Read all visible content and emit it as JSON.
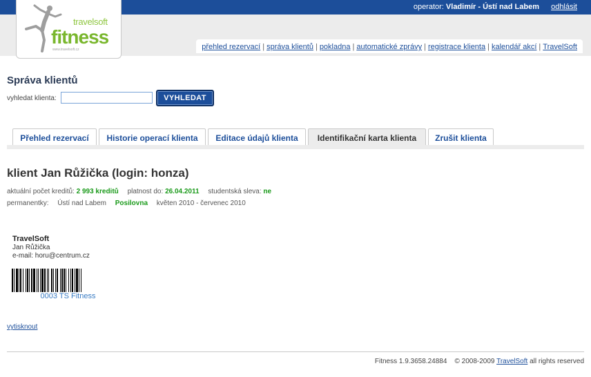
{
  "header": {
    "operator_label": "operator:",
    "operator_name": "Vladimír - Ústí nad Labem",
    "logout_label": "odhlásit"
  },
  "logo": {
    "brand_top": "travelsoft",
    "brand_main": "fitness",
    "tagline": "www.travelsoft.cz",
    "colors": {
      "green": "#7ab72e",
      "figure": "#9e9e9e"
    }
  },
  "nav": {
    "items": [
      {
        "label": "přehled rezervací"
      },
      {
        "label": "správa klientů"
      },
      {
        "label": "pokladna"
      },
      {
        "label": "automatické zprávy"
      },
      {
        "label": "registrace klienta"
      },
      {
        "label": "kalendář akcí"
      },
      {
        "label": "TravelSoft"
      }
    ],
    "separator": "|"
  },
  "search": {
    "title": "Správa klientů",
    "label": "vyhledat klienta:",
    "value": "",
    "placeholder": "",
    "button_label": "VYHLEDAT"
  },
  "tabs": {
    "items": [
      {
        "label": "Přehled rezervací"
      },
      {
        "label": "Historie operací klienta"
      },
      {
        "label": "Editace údajů klienta"
      },
      {
        "label": "Identifikační karta klienta",
        "active": true
      },
      {
        "label": "Zrušit klienta"
      }
    ]
  },
  "client": {
    "title": "klient Jan Růžička (login: honza)",
    "credits_label": "aktuální počet kreditů:",
    "credits_value": "2 993 kreditů",
    "valid_label": "platnost do:",
    "valid_value": "26.04.2011",
    "discount_label": "studentská sleva:",
    "discount_value": "ne",
    "passes_label": "permanentky:",
    "passes_location": "Ústí nad Labem",
    "passes_type": "Posilovna",
    "passes_period": "květen 2010 - červenec 2010"
  },
  "card": {
    "company": "TravelSoft",
    "name": "Jan Růžička",
    "email_line": "e-mail: horu@centrum.cz",
    "barcode_caption": "0003 TS Fitness"
  },
  "actions": {
    "print_label": "vytisknout"
  },
  "footer": {
    "version": "Fitness 1.9.3658.24884",
    "copyright_prefix": "© 2008-2009",
    "company_link": "TravelSoft",
    "copyright_suffix": "all rights reserved"
  },
  "colors": {
    "header_blue": "#1c4e9a",
    "link_blue": "#1c4e9a",
    "highlight_green": "#1a9a1a",
    "band_gray": "#ececec"
  }
}
